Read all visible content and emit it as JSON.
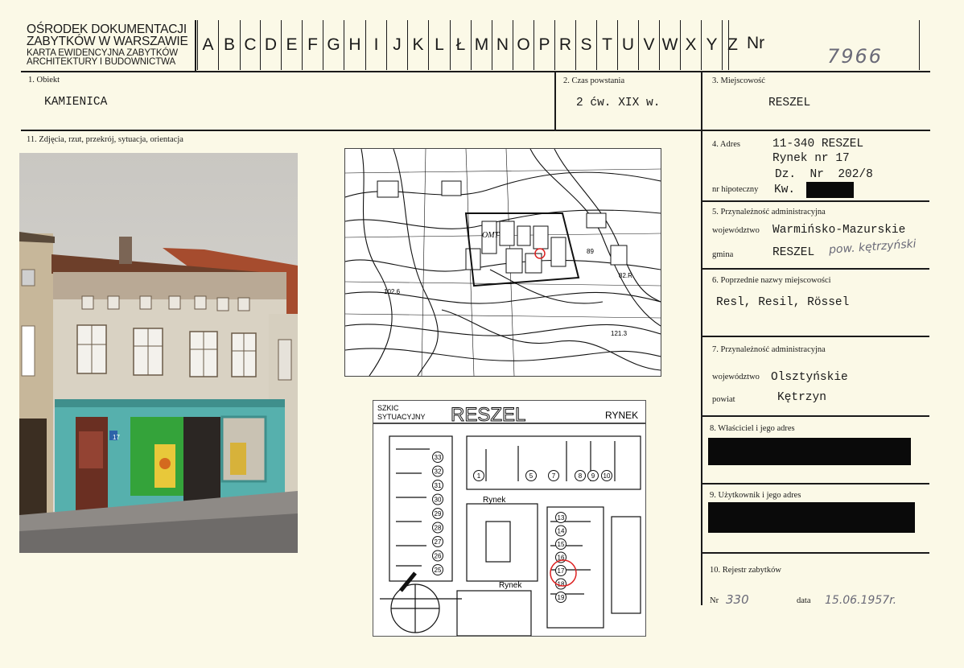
{
  "header": {
    "org_line1": "OŚRODEK DOKUMENTACJI",
    "org_line2": "ZABYTKÓW W WARSZAWIE",
    "sub_line1": "KARTA EWIDENCYJNA ZABYTKÓW",
    "sub_line2": "ARCHITEKTURY I BUDOWNICTWA",
    "letters": [
      "A",
      "B",
      "C",
      "D",
      "E",
      "F",
      "G",
      "H",
      "I",
      "J",
      "K",
      "L",
      "Ł",
      "M",
      "N",
      "O",
      "P",
      "R",
      "S",
      "T",
      "U",
      "V",
      "W",
      "X",
      "Y",
      "Z"
    ],
    "nr_label": "Nr",
    "nr_value": "7966"
  },
  "f1": {
    "label": "1. Obiekt",
    "value": "KAMIENICA"
  },
  "f2": {
    "label": "2. Czas powstania",
    "value": "2 ćw. XIX w."
  },
  "f3": {
    "label": "3. Miejscowość",
    "value": "RESZEL"
  },
  "f11": {
    "label": "11. Zdjęcia, rzut, przekrój, sytuacja, orientacja"
  },
  "f4": {
    "label": "4. Adres",
    "line1": "11-340 RESZEL",
    "line2": "Rynek nr 17",
    "line3": "Dz.  Nr  202/8",
    "hip_label": "nr hipoteczny",
    "kw": "Kw."
  },
  "f5": {
    "label": "5. Przynależność administracyjna",
    "woj_label": "województwo",
    "woj_value": "Warmińsko-Mazurskie",
    "gmina_label": "gmina",
    "gmina_value": "RESZEL",
    "gmina_note": "pow. kętrzyński"
  },
  "f6": {
    "label": "6. Poprzednie nazwy miejscowości",
    "value": "Resl, Resil, Rössel"
  },
  "f7": {
    "label": "7. Przynależność administracyjna",
    "woj_label": "województwo",
    "woj_value": "Olsztyńskie",
    "pow_label": "powiat",
    "pow_value": "Kętrzyn"
  },
  "f8": {
    "label": "8. Właściciel i jego adres"
  },
  "f9": {
    "label": "9. Użytkownik i jego adres"
  },
  "f10": {
    "label": "10. Rejestr zabytków",
    "nr_label": "Nr",
    "nr_value": "330",
    "data_label": "data",
    "data_value": "15.06.1957r."
  },
  "map": {
    "label_omt": "OMT",
    "label_a": "102.6",
    "label_b": "121.3",
    "label_c": "89",
    "label_d": "82.R"
  },
  "sketch": {
    "title_small1": "SZKIC",
    "title_small2": "SYTUACYJNY",
    "title": "RESZEL",
    "corner": "RYNEK",
    "street1": "Rynek",
    "street2": "Rynek",
    "top_numbers": [
      "1",
      "5",
      "7",
      "8",
      "9",
      "10"
    ],
    "left_numbers": [
      "33",
      "32",
      "31",
      "30",
      "29",
      "28",
      "27",
      "26",
      "25"
    ],
    "right_numbers": [
      "13",
      "14",
      "15",
      "16",
      "17",
      "18",
      "19"
    ]
  },
  "photo": {
    "shop_number": "17"
  }
}
